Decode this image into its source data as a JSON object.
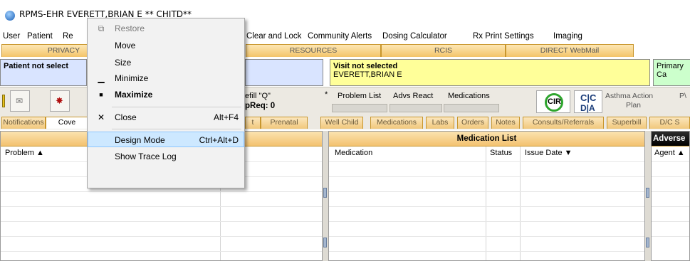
{
  "window": {
    "title": "RPMS-EHR EVERETT,BRIAN E   ** CHITD**"
  },
  "menubar": {
    "items": [
      "User",
      "Patient",
      "Re",
      "Clear and Lock",
      "Community Alerts",
      "Dosing Calculator",
      "Rx Print Settings",
      "Imaging"
    ]
  },
  "top_tabs": {
    "items": [
      "PRIVACY",
      "RESOURCES",
      "RCIS",
      "DIRECT WebMail"
    ]
  },
  "band": {
    "patient_label": "Patient not select",
    "visit_title": "Visit not selected",
    "visit_name": "EVERETT,BRIAN E",
    "primary": "Primary Ca"
  },
  "toolbar": {
    "refill_label": "efill \"Q\"",
    "pend_label": "pReq: 0",
    "links": [
      "Problem List",
      "Advs React",
      "Medications"
    ],
    "cir_label": "CIR",
    "cic_label": "C|C",
    "dia_label": "D|A",
    "asthma_label": "Asthma Action",
    "asthma_label2": "Plan",
    "pv_label": "P\\"
  },
  "chart_tabs": {
    "items": [
      "Notifications",
      "Cove",
      "t",
      "Prenatal",
      "Well Child",
      "Medications",
      "Labs",
      "Orders",
      "Notes",
      "Consults/Referrals",
      "Superbill",
      "D/C S"
    ]
  },
  "panels": {
    "left": {
      "col1": "Problem ▲"
    },
    "middle": {
      "title": "Medication List",
      "cols": [
        "Medication",
        "Status",
        "Issue Date ▼"
      ]
    },
    "right": {
      "title": "Adverse",
      "col1": "Agent ▲"
    }
  },
  "context_menu": {
    "items": [
      {
        "label": "Restore",
        "shortcut": "",
        "glyph": "⧉",
        "disabled": true
      },
      {
        "label": "Move",
        "shortcut": "",
        "glyph": "",
        "disabled": false
      },
      {
        "label": "Size",
        "shortcut": "",
        "glyph": "",
        "disabled": false
      },
      {
        "label": "Minimize",
        "shortcut": "",
        "glyph": "▁",
        "disabled": false
      },
      {
        "label": "Maximize",
        "shortcut": "",
        "glyph": "■",
        "disabled": false,
        "bold": true
      },
      {
        "label": "Close",
        "shortcut": "Alt+F4",
        "glyph": "✕",
        "disabled": false
      },
      {
        "label": "Design Mode",
        "shortcut": "Ctrl+Alt+D",
        "glyph": "",
        "disabled": false,
        "highlighted": true
      },
      {
        "label": "Show Trace Log",
        "shortcut": "",
        "glyph": "",
        "disabled": false
      }
    ]
  }
}
